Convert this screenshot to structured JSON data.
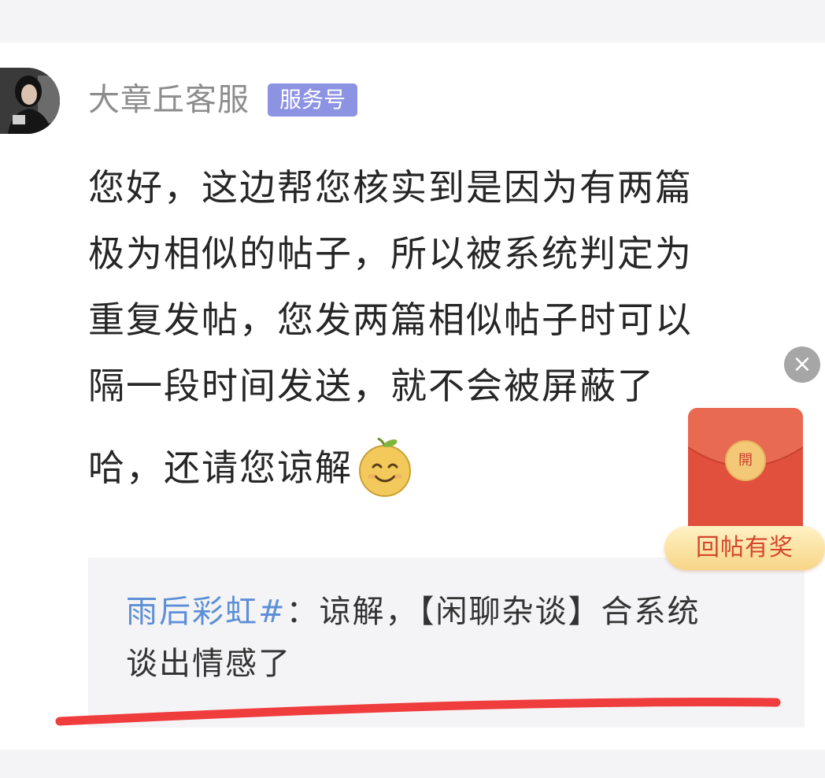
{
  "post": {
    "author": "大章丘客服",
    "badge": "服务号",
    "lines": [
      "您好，这边帮您核实到是因为有两篇",
      "极为相似的帖子，所以被系统判定为",
      "重复发帖，您发两篇相似帖子时可以",
      "隔一段时间发送，就不会被屏蔽了",
      "哈，还请您谅解"
    ],
    "emoji": "smile-emoji"
  },
  "reply": {
    "user": "雨后彩虹#",
    "separator": "：",
    "line1": "谅解，【闲聊杂谈】合系统",
    "line2": "谈出情感了"
  },
  "floating": {
    "close_symbol": "×",
    "seal_char": "開",
    "packet_label": "回帖有奖"
  },
  "colors": {
    "badge": "#8c93e3",
    "reply_user": "#5d8fd6",
    "underline": "#ef3c3c",
    "packet": "#e0503d"
  }
}
